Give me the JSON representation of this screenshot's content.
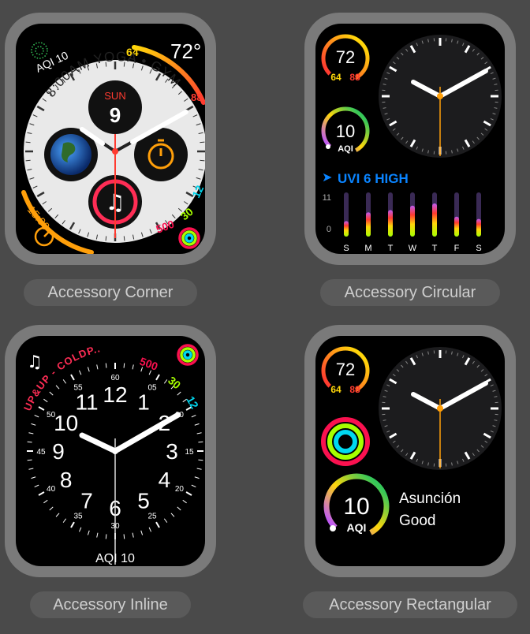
{
  "labels": {
    "corner": "Accessory Corner",
    "circular": "Accessory Circular",
    "inline": "Accessory Inline",
    "rectangular": "Accessory Rectangular"
  },
  "corner_face": {
    "aqi": "AQI 10",
    "calendar": "8:00AM YOGA • GYM",
    "day": "SUN",
    "date": "9",
    "temp": "72°",
    "temp_low": "64",
    "temp_high": "88",
    "timer": "15:00",
    "move": "500",
    "exercise": "30",
    "stand": "12"
  },
  "circular_face": {
    "temp": "72",
    "temp_low": "64",
    "temp_high": "88",
    "aqi": "10",
    "aqi_label": "AQI",
    "uvi_title": "UVI 6 HIGH",
    "uvi_max": "11",
    "uvi_min": "0",
    "uvi_days": [
      "S",
      "M",
      "T",
      "W",
      "T",
      "F",
      "S"
    ]
  },
  "inline_face": {
    "now_playing": "UP&UP - COLDP...",
    "move": "500",
    "exercise": "30",
    "stand": "12",
    "aqi_bottom": "AQI 10",
    "hours": [
      "12",
      "1",
      "2",
      "3",
      "4",
      "5",
      "6",
      "7",
      "8",
      "9",
      "10",
      "11"
    ],
    "minutes": [
      "60",
      "05",
      "10",
      "15",
      "20",
      "25",
      "30",
      "35",
      "40",
      "45",
      "50",
      "55"
    ]
  },
  "rect_face": {
    "temp": "72",
    "temp_low": "64",
    "temp_high": "88",
    "aqi": "10",
    "aqi_label": "AQI",
    "city": "Asunción",
    "quality": "Good"
  },
  "colors": {
    "bezel": "#7a7a7a",
    "background": "#4a4a4a",
    "pill": "#5a5a5a",
    "move": "#fa114f",
    "exercise": "#a6ff00",
    "stand": "#00d8f0",
    "accent_orange": "#ff9f0a"
  }
}
